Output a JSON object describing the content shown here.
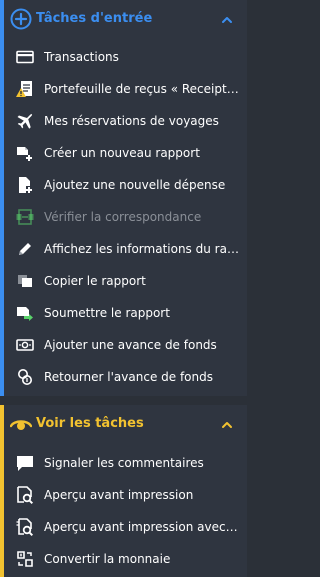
{
  "colors": {
    "accent_blue": "#3b8ef0",
    "accent_yellow": "#f2c230",
    "panel_bg": "#2f3540",
    "warning_yellow": "#f2c230",
    "money_green": "#5ad26b"
  },
  "section1": {
    "title": "Tâches d'entrée",
    "items": [
      {
        "label": "Transactions",
        "icon": "card-icon"
      },
      {
        "label": "Portefeuille de reçus « Receipt …",
        "icon": "receipt-warning-icon"
      },
      {
        "label": "Mes réservations de voyages",
        "icon": "airplane-icon"
      },
      {
        "label": "Créer un nouveau rapport",
        "icon": "new-report-icon"
      },
      {
        "label": "Ajoutez une nouvelle dépense",
        "icon": "add-expense-icon"
      },
      {
        "label": "Vérifier la correspondance",
        "icon": "match-icon",
        "disabled": true
      },
      {
        "label": "Affichez les informations du rapp…",
        "icon": "pencil-icon"
      },
      {
        "label": "Copier le rapport",
        "icon": "copy-icon"
      },
      {
        "label": "Soumettre le rapport",
        "icon": "submit-icon"
      },
      {
        "label": "Ajouter une avance de fonds",
        "icon": "cash-icon"
      },
      {
        "label": "Retourner l'avance de fonds",
        "icon": "coins-icon"
      }
    ]
  },
  "section2": {
    "title": "Voir les tâches",
    "items": [
      {
        "label": "Signaler les commentaires",
        "icon": "comment-icon"
      },
      {
        "label": "Aperçu avant impression",
        "icon": "print-preview-icon"
      },
      {
        "label": "Aperçu avant impression avec pi…",
        "icon": "print-preview-attach-icon"
      },
      {
        "label": "Convertir la monnaie",
        "icon": "currency-convert-icon"
      }
    ]
  }
}
